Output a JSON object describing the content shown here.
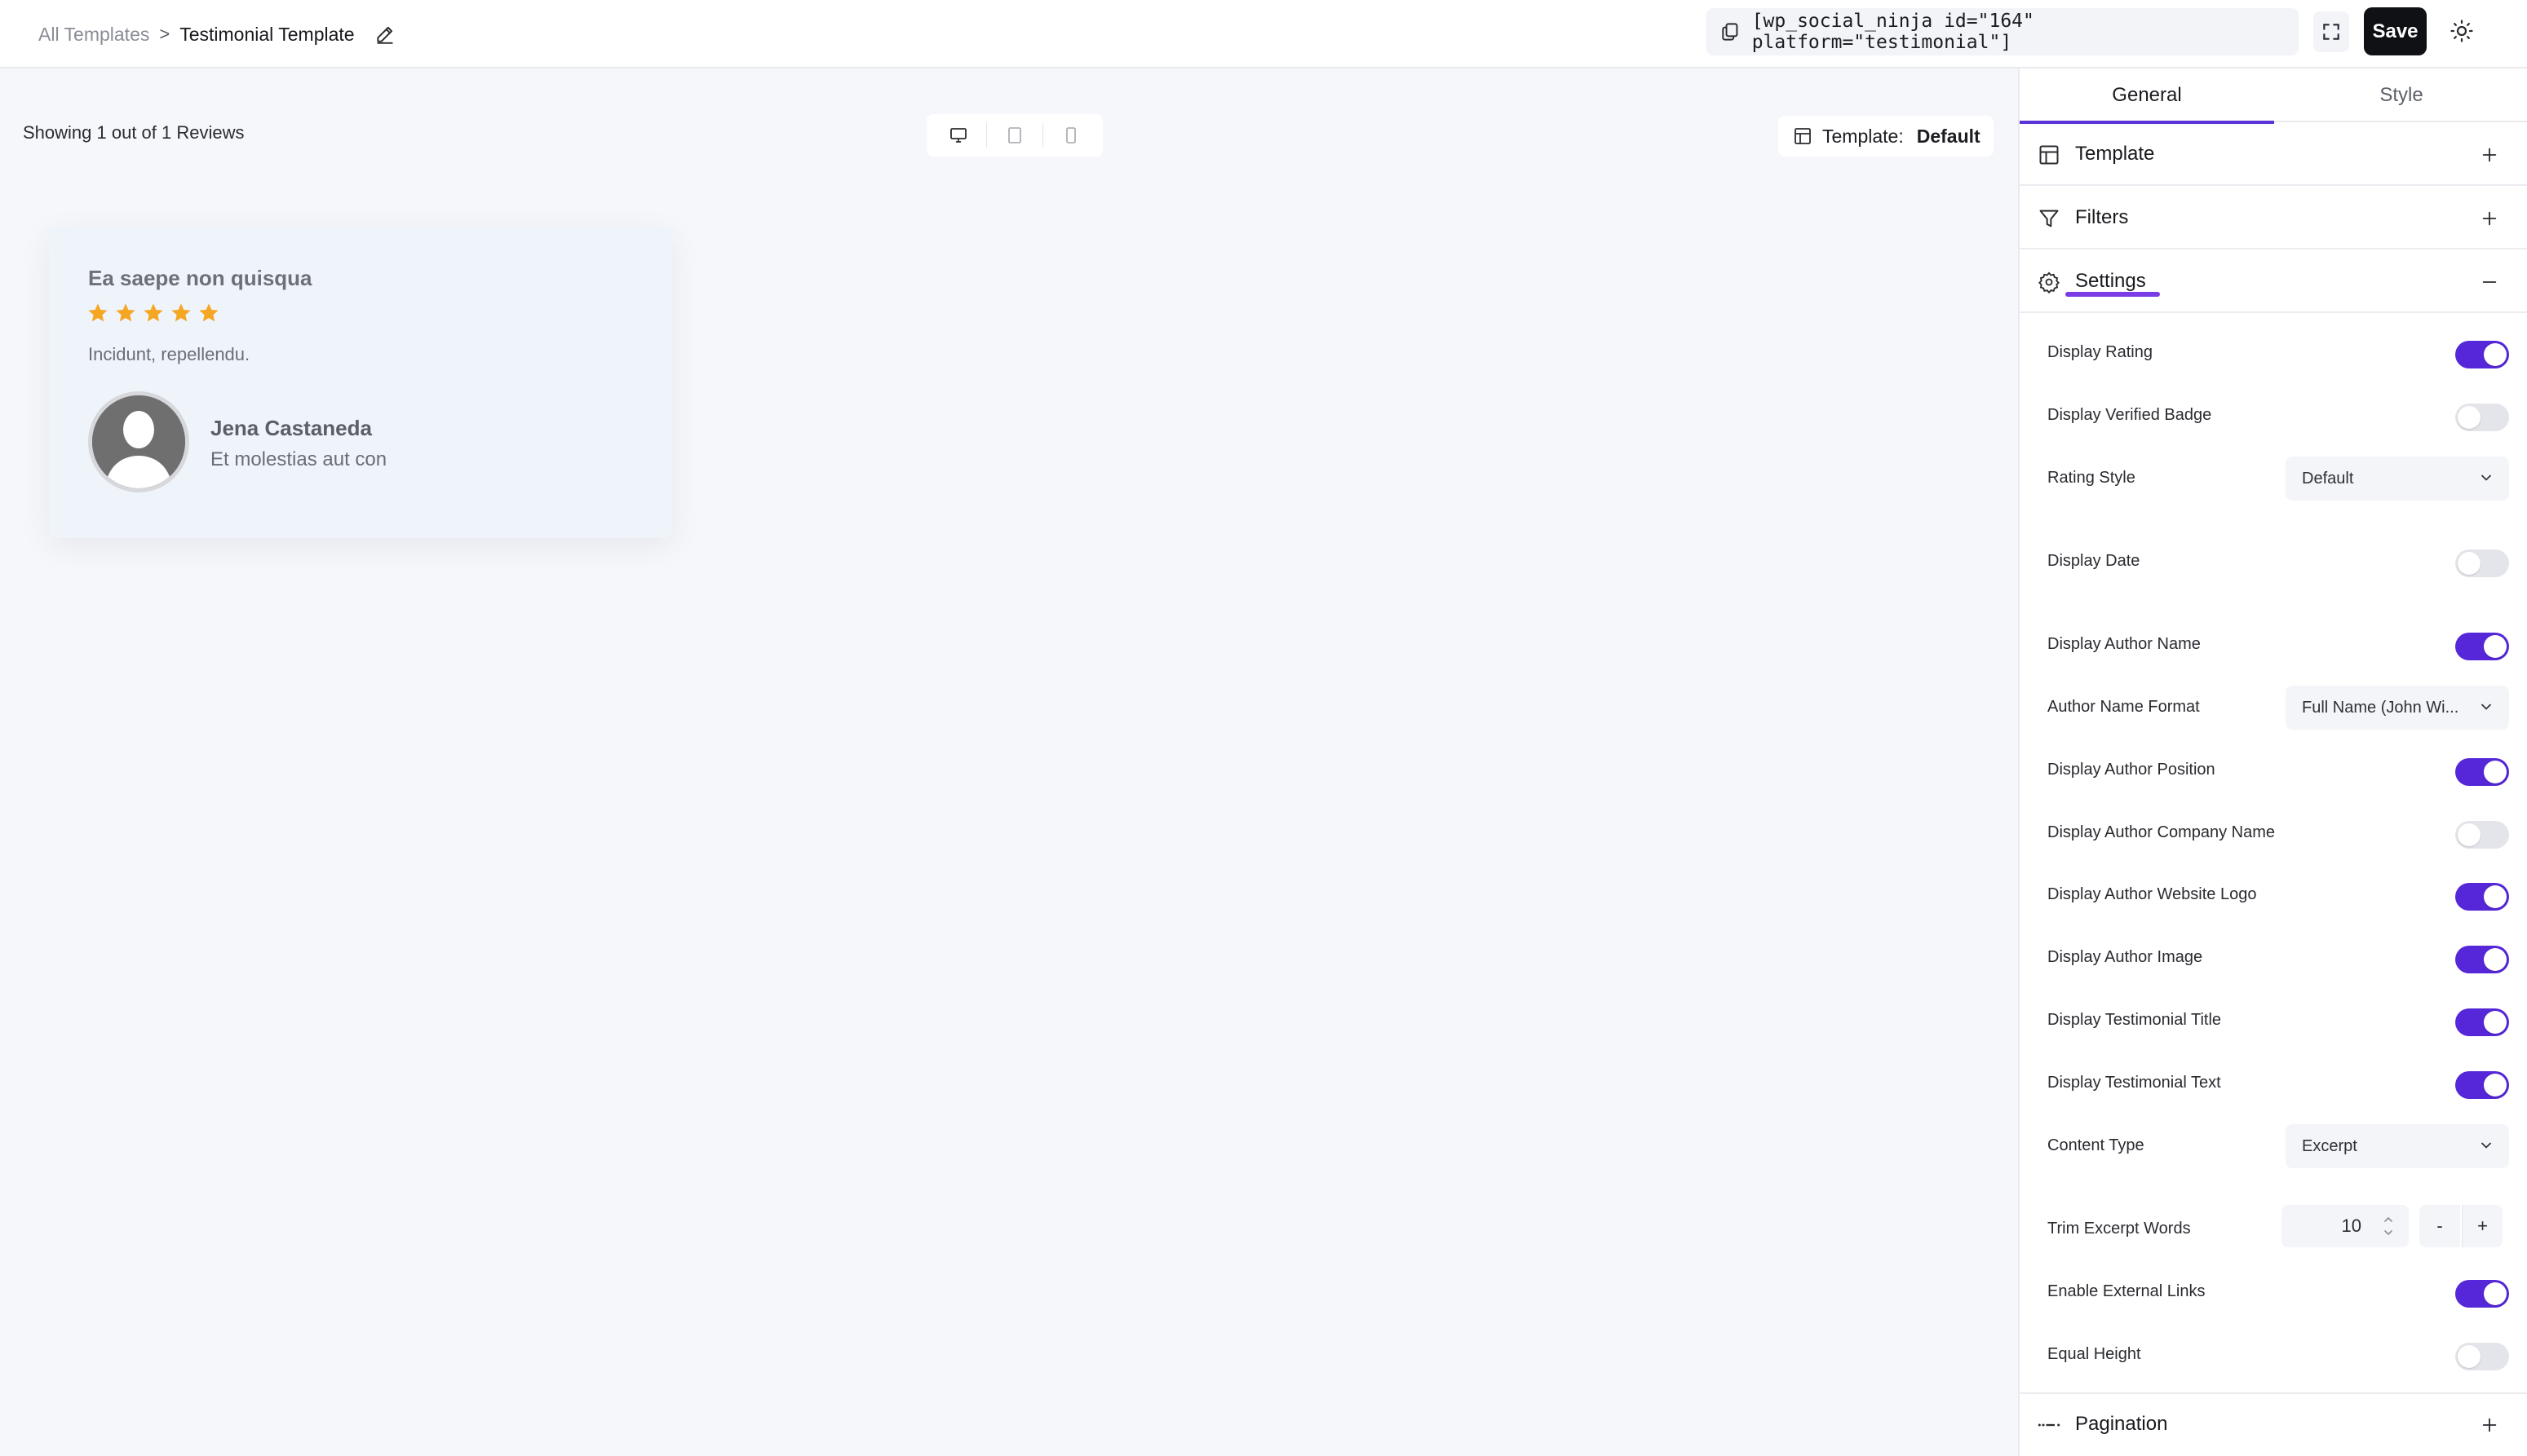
{
  "breadcrumb": {
    "root": "All Templates",
    "separator": ">",
    "current": "Testimonial Template"
  },
  "toolbar": {
    "shortcode": "[wp_social_ninja id=\"164\" platform=\"testimonial\"]",
    "save_label": "Save"
  },
  "canvas": {
    "showing_text": "Showing 1 out of 1 Reviews",
    "template_label": "Template:",
    "template_value": "Default"
  },
  "review": {
    "title": "Ea saepe non quisqua",
    "rating": 5,
    "text": "Incidunt, repellendu.",
    "author_name": "Jena Castaneda",
    "author_position": "Et molestias aut con"
  },
  "panel": {
    "tabs": [
      "General",
      "Style"
    ],
    "sections": {
      "template": "Template",
      "filters": "Filters",
      "settings": "Settings",
      "pagination": "Pagination"
    },
    "settings": {
      "display_rating": "Display Rating",
      "display_verified_badge": "Display Verified Badge",
      "rating_style": "Rating Style",
      "rating_style_value": "Default",
      "display_date": "Display Date",
      "display_author_name": "Display Author Name",
      "author_name_format": "Author Name Format",
      "author_name_format_value": "Full Name (John Wi...",
      "display_author_position": "Display Author Position",
      "display_author_company_name": "Display Author Company Name",
      "display_author_website_logo": "Display Author Website Logo",
      "display_author_image": "Display Author Image",
      "display_testimonial_title": "Display Testimonial Title",
      "display_testimonial_text": "Display Testimonial Text",
      "content_type": "Content Type",
      "content_type_value": "Excerpt",
      "trim_excerpt_words": "Trim Excerpt Words",
      "trim_excerpt_value": "10",
      "minus_label": "-",
      "plus_label": "+",
      "enable_external_links": "Enable External Links",
      "equal_height": "Equal Height"
    },
    "toggles": {
      "display_rating": true,
      "display_verified_badge": false,
      "display_date": false,
      "display_author_name": true,
      "display_author_position": true,
      "display_author_company_name": false,
      "display_author_website_logo": true,
      "display_author_image": true,
      "display_testimonial_title": true,
      "display_testimonial_text": true,
      "enable_external_links": true,
      "equal_height": false
    }
  },
  "colors": {
    "accent": "#5527d8",
    "star": "#f5a623",
    "save_button": "#101114"
  },
  "icons": {
    "edit": "pencil-icon",
    "copy": "copy-icon",
    "fullscreen": "expand-icon",
    "theme": "sun-icon"
  }
}
